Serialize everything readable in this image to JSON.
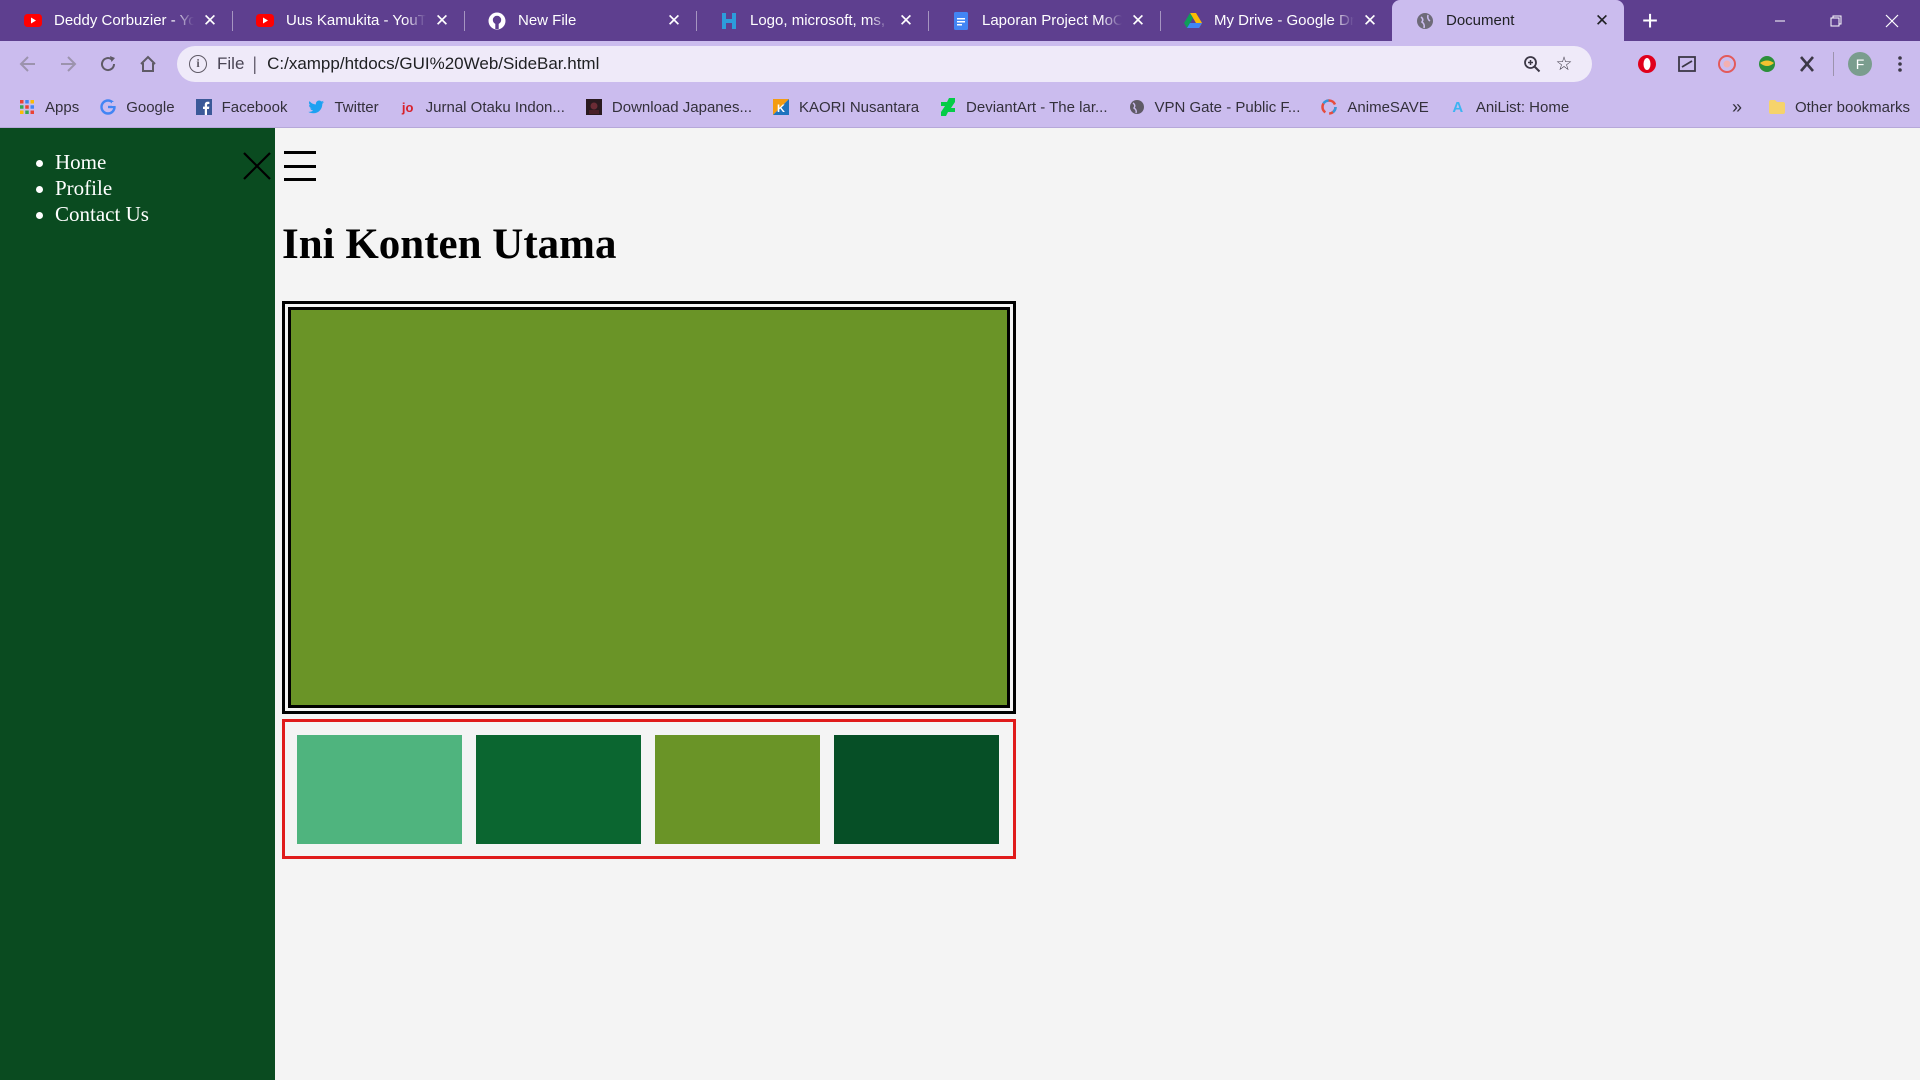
{
  "browser": {
    "tabs": [
      {
        "title": "Deddy Corbuzier - YouTube",
        "icon": "youtube-icon",
        "active": false
      },
      {
        "title": "Uus Kamukita - YouTube",
        "icon": "youtube-icon",
        "active": false
      },
      {
        "title": "New File",
        "icon": "github-icon",
        "active": false
      },
      {
        "title": "Logo, microsoft, ms, ka",
        "icon": "image-site-icon",
        "active": false
      },
      {
        "title": "Laporan Project MoCa",
        "icon": "google-docs-icon",
        "active": false
      },
      {
        "title": "My Drive - Google Drive",
        "icon": "google-drive-icon",
        "active": false
      },
      {
        "title": "Document",
        "icon": "globe-icon",
        "active": true
      }
    ],
    "address": {
      "scheme_label": "File",
      "url": "C:/xampp/htdocs/GUI%20Web/SideBar.html"
    },
    "profile_initial": "F",
    "bookmarks": [
      {
        "label": "Apps",
        "icon": "apps-grid-icon"
      },
      {
        "label": "Google",
        "icon": "google-icon"
      },
      {
        "label": "Facebook",
        "icon": "facebook-icon"
      },
      {
        "label": "Twitter",
        "icon": "twitter-icon"
      },
      {
        "label": "Jurnal Otaku Indon...",
        "icon": "jurnal-otaku-icon"
      },
      {
        "label": "Download Japanes...",
        "icon": "download-japanese-icon"
      },
      {
        "label": "KAORI Nusantara",
        "icon": "kaori-icon"
      },
      {
        "label": "DeviantArt - The lar...",
        "icon": "deviantart-icon"
      },
      {
        "label": "VPN Gate - Public F...",
        "icon": "vpngate-icon"
      },
      {
        "label": "AnimeSAVE",
        "icon": "animesave-icon"
      },
      {
        "label": "AniList: Home",
        "icon": "anilist-icon"
      }
    ],
    "bookmarks_more": "»",
    "other_bookmarks": "Other bookmarks"
  },
  "page": {
    "sidebar": {
      "items": [
        "Home",
        "Profile",
        "Contact Us"
      ],
      "background": "#0a4b20"
    },
    "title": "Ini Konten Utama",
    "hero_color": "#6a9427",
    "swatches": [
      "#4fb47e",
      "#0b6630",
      "#6a9427",
      "#064f26"
    ],
    "swatch_border_color": "#e01b1b"
  }
}
